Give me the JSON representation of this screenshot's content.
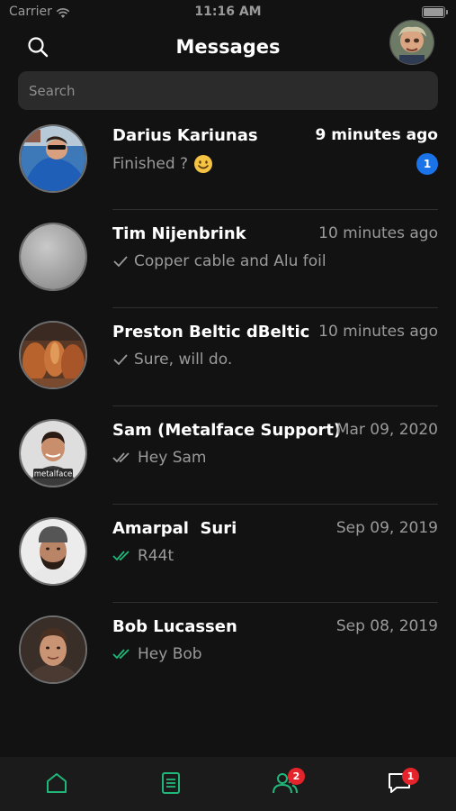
{
  "status_bar": {
    "carrier": "Carrier",
    "time": "11:16 AM"
  },
  "header": {
    "title": "Messages"
  },
  "search": {
    "placeholder": "Search"
  },
  "conversations": [
    {
      "name": "Darius Kariunas",
      "time": "9 minutes ago",
      "preview": "Finished ?",
      "status": "emoji",
      "unread_count": "1",
      "unread": true
    },
    {
      "name": "Tim Nijenbrink",
      "time": "10 minutes ago",
      "preview": "Copper cable and Alu foil",
      "status": "sent"
    },
    {
      "name": "Preston Beltic dBeltic",
      "time": "10 minutes ago",
      "preview": "Sure, will do.",
      "status": "sent"
    },
    {
      "name": "Sam (Metalface Support)",
      "time": "Mar 09, 2020",
      "preview": "Hey Sam",
      "status": "delivered",
      "avatar_label": "metalface"
    },
    {
      "name": "Amarpal  Suri",
      "time": "Sep 09, 2019",
      "preview": "R44t",
      "status": "read"
    },
    {
      "name": "Bob Lucassen",
      "time": "Sep 08, 2019",
      "preview": "Hey Bob",
      "status": "read"
    }
  ],
  "tabbar": {
    "tabs": [
      {
        "icon": "home-icon"
      },
      {
        "icon": "document-icon"
      },
      {
        "icon": "contacts-icon",
        "badge": "2"
      },
      {
        "icon": "chat-icon",
        "badge": "1"
      }
    ]
  },
  "colors": {
    "accent": "#1fb87a",
    "badge_red": "#e5232a",
    "unread_blue": "#1a73e8",
    "background": "#121212"
  }
}
